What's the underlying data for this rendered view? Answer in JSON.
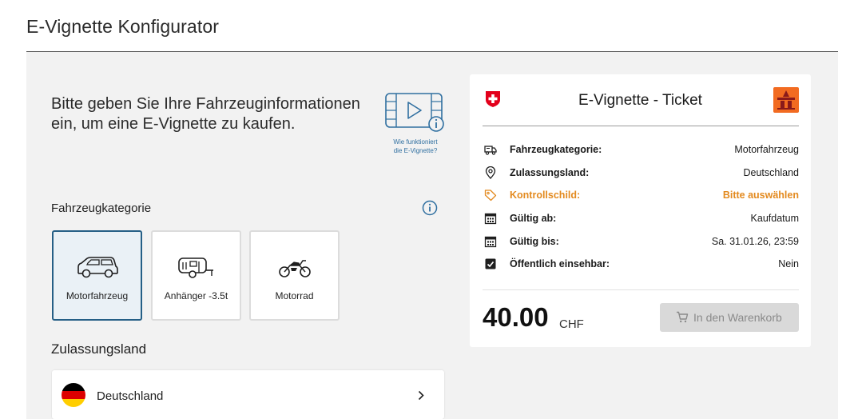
{
  "header": {
    "title": "E-Vignette Konfigurator"
  },
  "intro": {
    "text": "Bitte geben Sie Ihre Fahrzeuginformationen ein, um eine E-Vignette zu kaufen.",
    "howto_line1": "Wie funktioniert",
    "howto_line2": "die E-Vignette?"
  },
  "vehicle_category": {
    "label": "Fahrzeugkategorie",
    "options": [
      {
        "label": "Motorfahrzeug",
        "icon": "car-icon",
        "selected": true
      },
      {
        "label": "Anhänger -3.5t",
        "icon": "trailer-icon",
        "selected": false
      },
      {
        "label": "Motorrad",
        "icon": "motorcycle-icon",
        "selected": false
      }
    ]
  },
  "registration_country": {
    "label": "Zulassungsland",
    "value": "Deutschland",
    "flag_colors": [
      "#000000",
      "#dd0000",
      "#ffce00"
    ]
  },
  "ticket": {
    "title": "E-Vignette - Ticket",
    "rows": [
      {
        "icon": "truck-icon",
        "label": "Fahrzeugkategorie:",
        "value": "Motorfahrzeug"
      },
      {
        "icon": "location-pin-icon",
        "label": "Zulassungsland:",
        "value": "Deutschland"
      },
      {
        "icon": "tag-icon",
        "label": "Kontrollschild:",
        "value": "Bitte auswählen",
        "warning": true
      },
      {
        "icon": "calendar-icon",
        "label": "Gültig ab:",
        "value": "Kaufdatum"
      },
      {
        "icon": "calendar-icon",
        "label": "Gültig bis:",
        "value": "Sa. 31.01.26, 23:59"
      },
      {
        "icon": "checkbox-icon",
        "label": "Öffentlich einsehbar:",
        "value": "Nein"
      }
    ],
    "price": "40.00",
    "currency": "CHF",
    "cart_button": "In den Warenkorb"
  },
  "colors": {
    "accent": "#255f86",
    "warning": "#e38a1f",
    "swiss_red": "#e3001b",
    "vignette_orange": "#f26b21"
  }
}
